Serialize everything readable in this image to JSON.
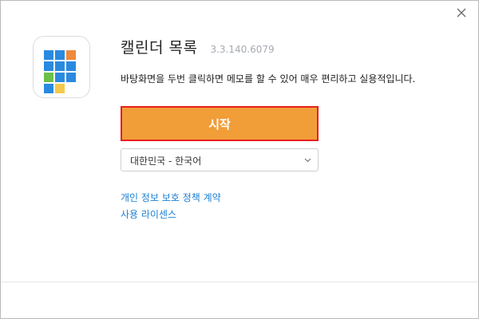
{
  "window": {
    "close_tooltip": ""
  },
  "app": {
    "name": "캘린더 목록",
    "version": "3.3.140.6079",
    "description": "바탕화면을 두번 클릭하면 메모를 할 수 있어 매우 편리하고 실용적입니다."
  },
  "actions": {
    "start_label": "시작"
  },
  "language": {
    "selected": "대한민국 - 한국어"
  },
  "links": {
    "privacy_policy": "개인 정보 보호 정책 계약",
    "license": "사용 라이센스"
  },
  "icons": {
    "close": "close-icon",
    "app": "calendar-grid-icon",
    "dropdown": "chevron-down-icon"
  },
  "colors": {
    "start_button_bg": "#f19d38",
    "start_button_border": "#e81f1f",
    "link": "#1b7fd4",
    "version_text": "#a6aab0"
  },
  "app_icon_tiles": [
    "#2a8ae0",
    "#2a8ae0",
    "#f08a3c",
    "#2a8ae0",
    "#2a8ae0",
    "#2a8ae0",
    "#6cc04a",
    "#2a8ae0",
    "#2a8ae0",
    "#2a8ae0",
    "#f5c84a",
    ""
  ]
}
